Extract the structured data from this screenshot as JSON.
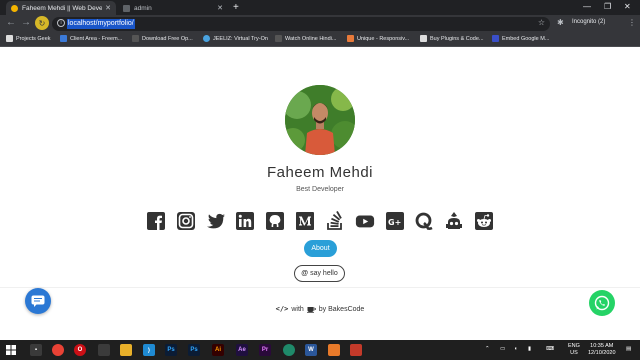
{
  "browser": {
    "tabs": [
      {
        "title": "Faheem Mehdi || Web Developer",
        "active": true
      },
      {
        "title": "admin",
        "active": false
      }
    ],
    "url": "localhost/myportfolio/",
    "profile": "Incognito (2)",
    "bookmarks": [
      "Projects Geek",
      "Client Area - Freem...",
      "Download Free Op...",
      "JEELIZ: Virtual Try-On",
      "Watch Online Hindi...",
      "Unique - Responsiv...",
      "Buy Plugins & Code...",
      "Embed Google M..."
    ]
  },
  "profile": {
    "name": "Faheem Mehdi",
    "role": "Best Developer",
    "socials": [
      "facebook-icon",
      "instagram-icon",
      "twitter-icon",
      "linkedin-icon",
      "github-icon",
      "medium-icon",
      "stackoverflow-icon",
      "youtube-icon",
      "google-plus-icon",
      "quora-icon",
      "codepen-icon",
      "reddit-icon"
    ],
    "about_label": "About",
    "hello_label": "say hello",
    "hello_symbol": "@"
  },
  "footer": {
    "code_symbol": "</>",
    "with": "with",
    "by": "by BakesCode"
  },
  "taskbar": {
    "lang": "ENG",
    "region": "US",
    "time": "10:35 AM",
    "date": "12/10/2020"
  },
  "colors": {
    "accent": "#2a9fd8",
    "whatsapp": "#25d366",
    "chat": "#2b78d4"
  }
}
